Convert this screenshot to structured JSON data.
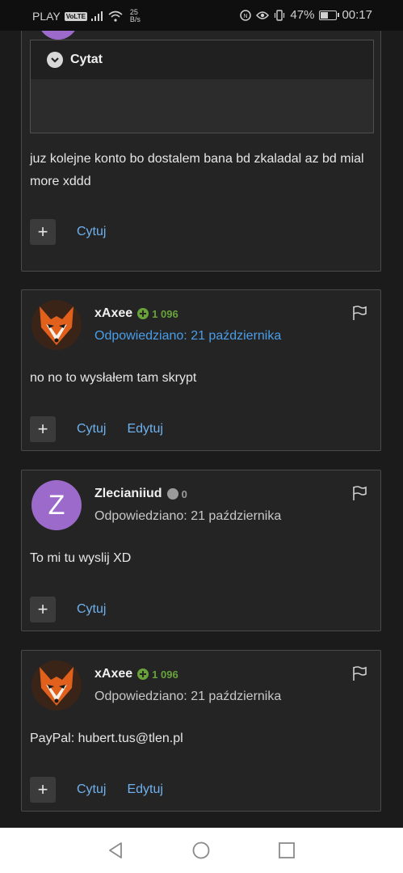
{
  "status_bar": {
    "carrier": "PLAY",
    "volte": "VoLTE",
    "speed_value": "25",
    "speed_unit": "B/s",
    "battery_percent": "47%",
    "battery_level": 0.47,
    "time": "00:17"
  },
  "posts": [
    {
      "quote_label": "Cytat",
      "text": "juz kolejne konto bo dostalem bana bd zkaladal az bd mial more xddd",
      "actions": [
        "Cytuj"
      ]
    },
    {
      "author": "xAxee",
      "reputation": "1 096",
      "date": "Odpowiedziano: 21 października",
      "text": "no no to wysłałem tam skrypt",
      "actions": [
        "Cytuj",
        "Edytuj"
      ]
    },
    {
      "author": "Zlecianiiud",
      "avatar_letter": "Z",
      "reputation": "0",
      "date": "Odpowiedziano: 21 października",
      "text": "To mi tu wyslij XD",
      "actions": [
        "Cytuj"
      ]
    },
    {
      "author": "xAxee",
      "reputation": "1 096",
      "date": "Odpowiedziano: 21 października",
      "text": "PayPal: hubert.tus@tlen.pl",
      "actions": [
        "Cytuj",
        "Edytuj"
      ]
    }
  ],
  "plus_label": "+",
  "colors": {
    "background": "#1b1b1b",
    "card": "#242424",
    "link": "#6fb1ee",
    "date_link": "#4a9ee8",
    "reputation_positive": "#68a33a",
    "reputation_neutral": "#9b9b9b",
    "avatar_z": "#9b6acb"
  }
}
